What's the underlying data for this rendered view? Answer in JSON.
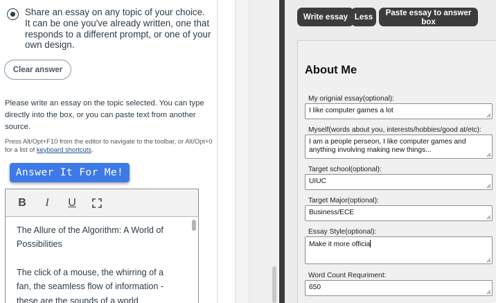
{
  "left": {
    "radio_option": "Share an essay on any topic of your choice. It can be one you've already written, one that responds to a different prompt, or one of your own design.",
    "clear_button": "Clear answer",
    "instructions": "Please write an essay on the topic selected. You can type directly into the box, or you can paste text from another source.",
    "hint_prefix": "Press Alt/Opt+F10 from the editor to navigate to the toolbar, or Alt/Opt+0 for a list of ",
    "hint_link": "keyboard shortcuts",
    "hint_suffix": ".",
    "answer_button": "Answer It For Me!",
    "toolbar": {
      "bold": "B",
      "italic": "I",
      "underline": "U"
    },
    "editor_paragraphs": [
      "The Allure of the Algorithm: A World of Possibilities",
      "The click of a mouse, the whirring of a fan, the seamless flow of information - these are the sounds of a world"
    ]
  },
  "right": {
    "buttons": {
      "write": "Write essay",
      "less": "Less",
      "paste": "Paste essay to answer box"
    },
    "form_title": "About Me",
    "fields": {
      "original_essay": {
        "label": "My orignial essay(optional):",
        "value": "I like computer games a lot"
      },
      "myself": {
        "label": "Myself(words about you, interests/hobbies/good at/etc):",
        "value": "I am a people perseon, I like computer games and anything involving making new things..."
      },
      "target_school": {
        "label": "Target school(optional):",
        "value": "UIUC"
      },
      "target_major": {
        "label": "Target Major(optional):",
        "value": "Business/ECE"
      },
      "essay_style": {
        "label": "Essay Style(optional):",
        "value": "Make it more officia"
      },
      "word_count": {
        "label": "Word Count Requriment:",
        "value": "650"
      }
    }
  }
}
